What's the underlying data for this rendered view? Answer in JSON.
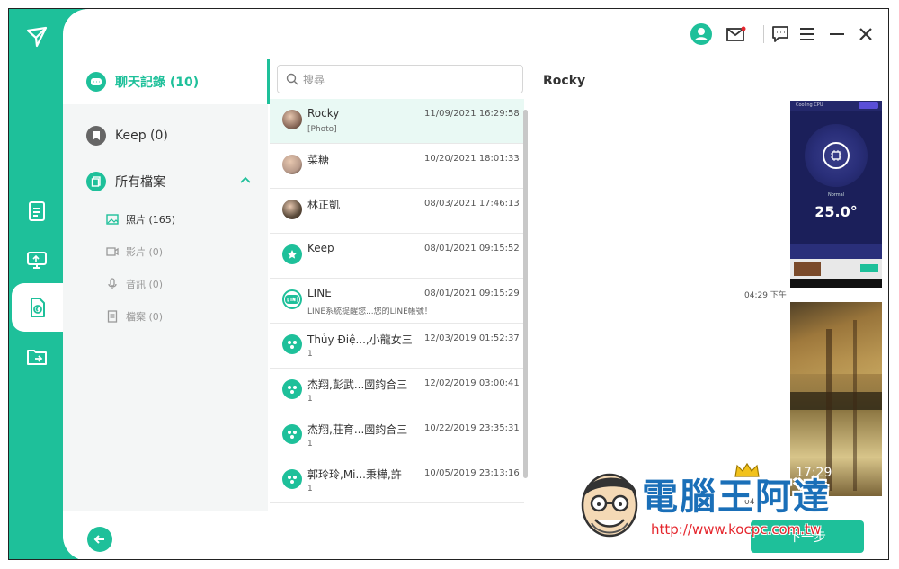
{
  "sidebar": {
    "items": [
      {
        "label": "聊天記錄 (10)",
        "icon": "chat-bubble-icon",
        "active": true
      },
      {
        "label": "Keep (0)",
        "icon": "bookmark-icon",
        "active": false
      },
      {
        "label": "所有檔案",
        "icon": "files-icon",
        "active": false
      }
    ],
    "subitems": [
      {
        "label": "照片 (165)",
        "icon": "image-icon",
        "active": true
      },
      {
        "label": "影片 (0)",
        "icon": "video-icon",
        "active": false
      },
      {
        "label": "音訊 (0)",
        "icon": "mic-icon",
        "active": false
      },
      {
        "label": "檔案 (0)",
        "icon": "document-icon",
        "active": false
      }
    ]
  },
  "search": {
    "placeholder": "搜尋"
  },
  "chats": [
    {
      "name": "Rocky",
      "time": "11/09/2021 16:29:58",
      "preview": "[Photo]",
      "avatar": "photo",
      "selected": true
    },
    {
      "name": "菜糖",
      "time": "10/20/2021 18:01:33",
      "preview": "",
      "avatar": "photo"
    },
    {
      "name": "林正凱",
      "time": "08/03/2021 17:46:13",
      "preview": "",
      "avatar": "photo"
    },
    {
      "name": "Keep",
      "time": "08/01/2021 09:15:52",
      "preview": "",
      "avatar": "keep"
    },
    {
      "name": "LINE",
      "time": "08/01/2021 09:15:29",
      "preview": "LINE系統提醒您...您的LINE帳號！",
      "avatar": "line"
    },
    {
      "name": "Thủy Điệ...,小龍女三",
      "time": "12/03/2019 01:52:37",
      "preview": "1",
      "avatar": "group"
    },
    {
      "name": "杰翔,彭武...國鈞合三",
      "time": "12/02/2019 03:00:41",
      "preview": "1",
      "avatar": "group"
    },
    {
      "name": "杰翔,莊育...國鈞合三",
      "time": "10/22/2019 23:35:31",
      "preview": "1",
      "avatar": "group"
    },
    {
      "name": "郭玲玲,Mi...秉樺,許",
      "time": "10/05/2019 23:13:16",
      "preview": "1",
      "avatar": "group"
    }
  ],
  "chat_view": {
    "title": "Rocky",
    "timestamp_1": "04:29 下午",
    "timestamp_2": "04:29 下午",
    "photo1_app": "Cooling CPU",
    "photo1_label": "Normal",
    "photo1_temp": "25.0°",
    "photo2_clock": "17:29"
  },
  "footer": {
    "next_label": "下一步"
  },
  "watermark": {
    "title": "電腦王阿達",
    "url": "http://www.kocpc.com.tw"
  },
  "colors": {
    "accent": "#1ec09a",
    "watermark_blue": "#1a6fb8",
    "watermark_red": "#e5262d"
  }
}
